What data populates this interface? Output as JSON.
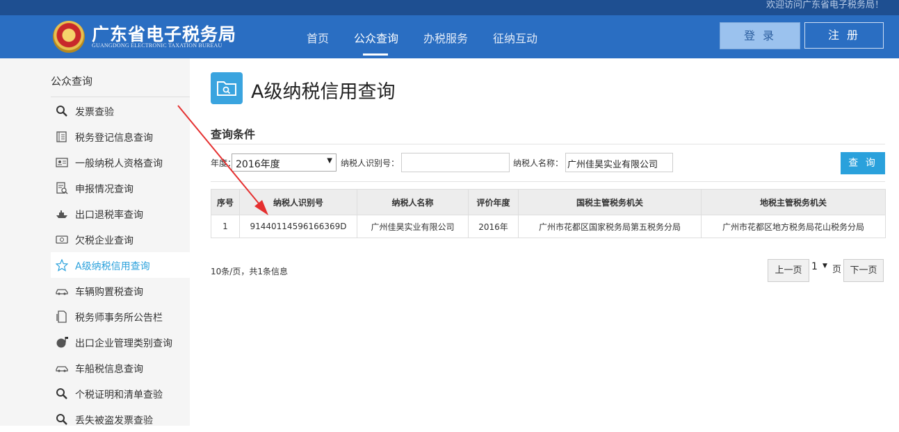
{
  "topbar": {
    "welcome": "欢迎访问广东省电子税务局！"
  },
  "header": {
    "logo_title": "广东省电子税务局",
    "logo_subtitle": "GUANGDONG ELECTRONIC TAXATION BUREAU",
    "nav": [
      {
        "label": "首页"
      },
      {
        "label": "公众查询",
        "active": true
      },
      {
        "label": "办税服务"
      },
      {
        "label": "征纳互动"
      }
    ],
    "login": "登 录",
    "register": "注 册"
  },
  "sidebar": {
    "heading": "公众查询",
    "items": [
      {
        "label": "发票查验",
        "icon": "magnifier-icon"
      },
      {
        "label": "税务登记信息查询",
        "icon": "register-book-icon"
      },
      {
        "label": "一般纳税人资格查询",
        "icon": "id-card-icon"
      },
      {
        "label": "申报情况查询",
        "icon": "report-doc-icon"
      },
      {
        "label": "出口退税率查询",
        "icon": "ship-icon"
      },
      {
        "label": "欠税企业查询",
        "icon": "card-icon"
      },
      {
        "label": "A级纳税信用查询",
        "icon": "star-icon",
        "active": true
      },
      {
        "label": "车辆购置税查询",
        "icon": "car-icon"
      },
      {
        "label": "税务师事务所公告栏",
        "icon": "bulletin-icon"
      },
      {
        "label": "出口企业管理类别查询",
        "icon": "globe-flag-icon"
      },
      {
        "label": "车船税信息查询",
        "icon": "car-icon"
      },
      {
        "label": "个税证明和清单查验",
        "icon": "magnifier-icon"
      },
      {
        "label": "丢失被盗发票查验",
        "icon": "magnifier-icon"
      }
    ]
  },
  "main": {
    "title": "A级纳税信用查询",
    "section": "查询条件",
    "filters": {
      "year_label": "年度：",
      "year_value": "2016年度",
      "taxid_label": "纳税人识别号：",
      "taxid_value": "",
      "name_label": "纳税人名称：",
      "name_value": "广州佳昊实业有限公司",
      "query_button": "查 询"
    },
    "table": {
      "headers": [
        "序号",
        "纳税人识别号",
        "纳税人名称",
        "评价年度",
        "国税主管税务机关",
        "地税主管税务机关"
      ],
      "rows": [
        [
          "1",
          "91440114596166369D",
          "广州佳昊实业有限公司",
          "2016年",
          "广州市花都区国家税务局第五税务分局",
          "广州市花都区地方税务局花山税务分局"
        ]
      ]
    },
    "pager": {
      "info": "10条/页，共1条信息",
      "prev": "上一页",
      "page": "1",
      "unit": "页",
      "next": "下一页"
    }
  },
  "colors": {
    "header_blue": "#2a6ec2",
    "accent": "#2aa1dc",
    "annotation_arrow": "#e53030"
  }
}
